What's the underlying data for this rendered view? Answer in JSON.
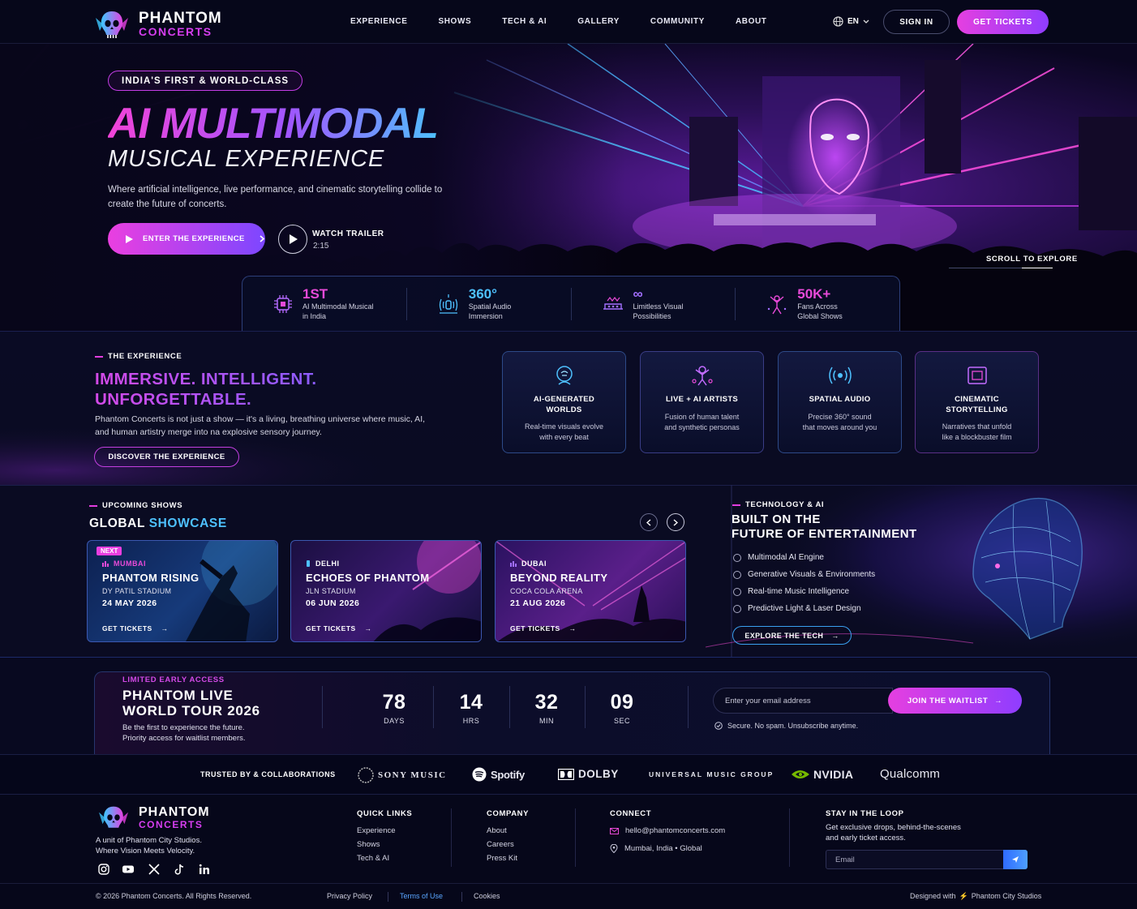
{
  "brand": {
    "name_line1": "PHANTOM",
    "name_line2": "CONCERTS"
  },
  "nav": {
    "links": [
      "EXPERIENCE",
      "SHOWS",
      "TECH & AI",
      "GALLERY",
      "COMMUNITY",
      "ABOUT"
    ],
    "language": "EN",
    "sign_in": "SIGN IN",
    "get_tickets": "GET TICKETS"
  },
  "hero": {
    "badge": "INDIA'S FIRST & WORLD-CLASS",
    "title_line1": "AI MULTIMODAL",
    "title_line2": "MUSICAL EXPERIENCE",
    "description": "Where artificial intelligence, live performance, and cinematic storytelling collide to create the future of concerts.",
    "enter_button": "ENTER THE EXPERIENCE",
    "trailer_label": "WATCH TRAILER",
    "trailer_duration": "2:15",
    "scroll_label": "SCROLL TO EXPLORE"
  },
  "stats": [
    {
      "value": "1ST",
      "label_line1": "AI Multimodal Musical",
      "label_line2": "in India",
      "icon": "chip-icon",
      "color": "#e84ad8"
    },
    {
      "value": "360°",
      "label_line1": "Spatial Audio",
      "label_line2": "Immersion",
      "icon": "spatial-audio-icon",
      "color": "#4ec1ff"
    },
    {
      "value": "∞",
      "label_line1": "Limitless Visual",
      "label_line2": "Possibilities",
      "icon": "stage-icon",
      "color": "#a270ff"
    },
    {
      "value": "50K+",
      "label_line1": "Fans Across",
      "label_line2": "Global Shows",
      "icon": "fans-icon",
      "color": "#e84ad8"
    }
  ],
  "experience": {
    "eyebrow": "THE EXPERIENCE",
    "heading_line1": "IMMERSIVE. INTELLIGENT.",
    "heading_line2": "UNFORGETTABLE.",
    "description": "Phantom Concerts is not just a show — it's a living, breathing universe where music, AI, and human artistry merge into na explosive sensory journey.",
    "cta": "DISCOVER THE EXPERIENCE",
    "cards": [
      {
        "title_line1": "AI-GENERATED",
        "title_line2": "WORLDS",
        "desc_line1": "Real-time visuals evolve",
        "desc_line2": "with every beat",
        "icon": "ai-head-icon"
      },
      {
        "title_line1": "LIVE + AI ARTISTS",
        "title_line2": "",
        "desc_line1": "Fusion of human talent",
        "desc_line2": "and synthetic personas",
        "icon": "artists-icon"
      },
      {
        "title_line1": "SPATIAL AUDIO",
        "title_line2": "",
        "desc_line1": "Precise 360° sound",
        "desc_line2": "that moves around you",
        "icon": "sound-waves-icon"
      },
      {
        "title_line1": "CINEMATIC",
        "title_line2": "STORYTELLING",
        "desc_line1": "Narratives that unfold",
        "desc_line2": "like a blockbuster film",
        "icon": "film-frame-icon"
      }
    ]
  },
  "shows": {
    "eyebrow": "UPCOMING SHOWS",
    "heading_a": "GLOBAL",
    "heading_b": "SHOWCASE",
    "next_badge": "NEXT",
    "cards": [
      {
        "city": "MUMBAI",
        "title": "PHANTOM RISING",
        "venue": "DY PATIL STADIUM",
        "date": "24 MAY 2026",
        "cta": "GET TICKETS"
      },
      {
        "city": "DELHI",
        "title": "ECHOES OF PHANTOM",
        "venue": "JLN STADIUM",
        "date": "06 JUN 2026",
        "cta": "GET TICKETS"
      },
      {
        "city": "DUBAI",
        "title": "BEYOND REALITY",
        "venue": "COCA COLA ARENA",
        "date": "21 AUG 2026",
        "cta": "GET TICKETS"
      }
    ]
  },
  "tech": {
    "eyebrow": "TECHNOLOGY & AI",
    "heading_line1": "BUILT ON THE",
    "heading_line2": "FUTURE OF ENTERTAINMENT",
    "items": [
      "Multimodal AI Engine",
      "Generative Visuals & Environments",
      "Real-time Music Intelligence",
      "Predictive Light & Laser Design"
    ],
    "cta": "EXPLORE THE TECH"
  },
  "waitlist": {
    "eyebrow": "LIMITED EARLY ACCESS",
    "heading_line1": "PHANTOM LIVE",
    "heading_line2": "WORLD TOUR 2026",
    "desc_line1": "Be the first to experience the future.",
    "desc_line2": "Priority access for waitlist members.",
    "countdown": [
      {
        "value": "78",
        "unit": "DAYS"
      },
      {
        "value": "14",
        "unit": "HRS"
      },
      {
        "value": "32",
        "unit": "MIN"
      },
      {
        "value": "09",
        "unit": "SEC"
      }
    ],
    "email_placeholder": "Enter your email address",
    "join_button": "JOIN THE WAITLIST",
    "secure_note": "Secure. No spam. Unsubscribe anytime."
  },
  "trusted": {
    "label": "TRUSTED BY & COLLABORATIONS",
    "brands": [
      "SONY MUSIC",
      "Spotify",
      "DOLBY",
      "UNIVERSAL MUSIC GROUP",
      "NVIDIA",
      "Qualcomm"
    ]
  },
  "footer": {
    "brand_line1": "PHANTOM",
    "brand_line2": "CONCERTS",
    "tagline_line1": "A unit of Phantom City Studios.",
    "tagline_line2": "Where Vision Meets Velocity.",
    "quick_links_title": "QUICK LINKS",
    "quick_links": [
      "Experience",
      "Shows",
      "Tech & AI"
    ],
    "company_title": "COMPANY",
    "company_links": [
      "About",
      "Careers",
      "Press Kit"
    ],
    "connect_title": "CONNECT",
    "email": "hello@phantomconcerts.com",
    "location": "Mumbai, India • Global",
    "newsletter_title": "STAY IN THE LOOP",
    "newsletter_line1": "Get exclusive drops, behind-the-scenes",
    "newsletter_line2": "and early ticket access.",
    "newsletter_placeholder": "Email",
    "copyright": "© 2026 Phantom Concerts. All Rights Reserved.",
    "legal": [
      "Privacy Policy",
      "Terms of Use",
      "Cookies"
    ],
    "designed_prefix": "Designed with",
    "designed_by": "Phantom City Studios"
  },
  "colors": {
    "magenta": "#e53fe0",
    "violet": "#8f3dff",
    "cyan": "#4ec1ff",
    "background": "#07081a"
  }
}
